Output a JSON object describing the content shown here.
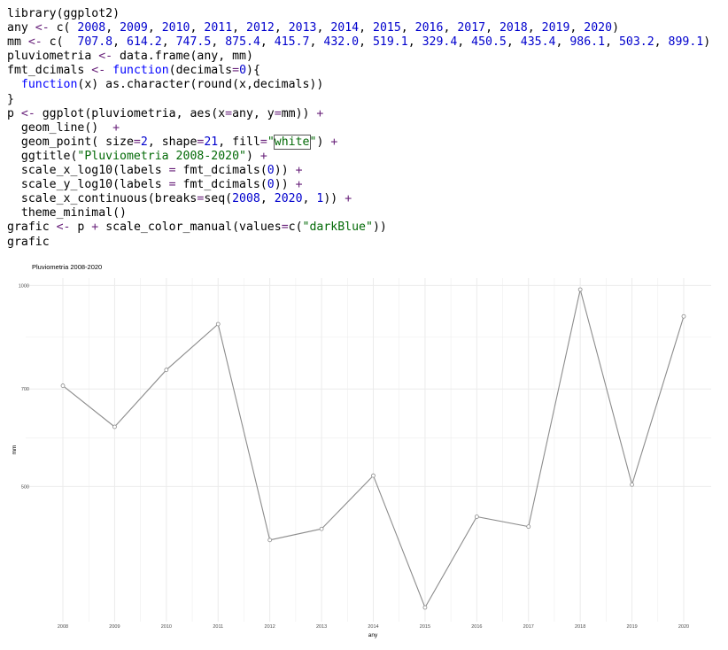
{
  "code": {
    "lines": [
      [
        {
          "t": "library(ggplot2)"
        }
      ],
      [
        {
          "t": "any "
        },
        {
          "t": "<-",
          "c": "op"
        },
        {
          "t": " c( "
        },
        {
          "t": "2008",
          "c": "num"
        },
        {
          "t": ", "
        },
        {
          "t": "2009",
          "c": "num"
        },
        {
          "t": ", "
        },
        {
          "t": "2010",
          "c": "num"
        },
        {
          "t": ", "
        },
        {
          "t": "2011",
          "c": "num"
        },
        {
          "t": ", "
        },
        {
          "t": "2012",
          "c": "num"
        },
        {
          "t": ", "
        },
        {
          "t": "2013",
          "c": "num"
        },
        {
          "t": ", "
        },
        {
          "t": "2014",
          "c": "num"
        },
        {
          "t": ", "
        },
        {
          "t": "2015",
          "c": "num"
        },
        {
          "t": ", "
        },
        {
          "t": "2016",
          "c": "num"
        },
        {
          "t": ", "
        },
        {
          "t": "2017",
          "c": "num"
        },
        {
          "t": ", "
        },
        {
          "t": "2018",
          "c": "num"
        },
        {
          "t": ", "
        },
        {
          "t": "2019",
          "c": "num"
        },
        {
          "t": ", "
        },
        {
          "t": "2020",
          "c": "num"
        },
        {
          "t": ")"
        }
      ],
      [
        {
          "t": "mm "
        },
        {
          "t": "<-",
          "c": "op"
        },
        {
          "t": " c(  "
        },
        {
          "t": "707.8",
          "c": "num"
        },
        {
          "t": ", "
        },
        {
          "t": "614.2",
          "c": "num"
        },
        {
          "t": ", "
        },
        {
          "t": "747.5",
          "c": "num"
        },
        {
          "t": ", "
        },
        {
          "t": "875.4",
          "c": "num"
        },
        {
          "t": ", "
        },
        {
          "t": "415.7",
          "c": "num"
        },
        {
          "t": ", "
        },
        {
          "t": "432.0",
          "c": "num"
        },
        {
          "t": ", "
        },
        {
          "t": "519.1",
          "c": "num"
        },
        {
          "t": ", "
        },
        {
          "t": "329.4",
          "c": "num"
        },
        {
          "t": ", "
        },
        {
          "t": "450.5",
          "c": "num"
        },
        {
          "t": ", "
        },
        {
          "t": "435.4",
          "c": "num"
        },
        {
          "t": ", "
        },
        {
          "t": "986.1",
          "c": "num"
        },
        {
          "t": ", "
        },
        {
          "t": "503.2",
          "c": "num"
        },
        {
          "t": ", "
        },
        {
          "t": "899.1",
          "c": "num"
        },
        {
          "t": ")"
        }
      ],
      [
        {
          "t": "pluviometria "
        },
        {
          "t": "<-",
          "c": "op"
        },
        {
          "t": " data.frame(any, mm)"
        }
      ],
      [
        {
          "t": "fmt_dcimals "
        },
        {
          "t": "<-",
          "c": "op"
        },
        {
          "t": " "
        },
        {
          "t": "function",
          "c": "kw"
        },
        {
          "t": "(decimals"
        },
        {
          "t": "=",
          "c": "op"
        },
        {
          "t": "0",
          "c": "num"
        },
        {
          "t": "){"
        }
      ],
      [
        {
          "t": "  "
        },
        {
          "t": "function",
          "c": "kw"
        },
        {
          "t": "(x) as.character(round(x,decimals))"
        }
      ],
      [
        {
          "t": "}"
        }
      ],
      [
        {
          "t": "p "
        },
        {
          "t": "<-",
          "c": "op"
        },
        {
          "t": " ggplot(pluviometria, aes(x"
        },
        {
          "t": "=",
          "c": "op"
        },
        {
          "t": "any, y"
        },
        {
          "t": "=",
          "c": "op"
        },
        {
          "t": "mm)) "
        },
        {
          "t": "+",
          "c": "op"
        }
      ],
      [
        {
          "t": "  geom_line()  "
        },
        {
          "t": "+",
          "c": "op"
        }
      ],
      [
        {
          "t": "  geom_point( size"
        },
        {
          "t": "=",
          "c": "op"
        },
        {
          "t": "2",
          "c": "num"
        },
        {
          "t": ", shape"
        },
        {
          "t": "=",
          "c": "op"
        },
        {
          "t": "21",
          "c": "num"
        },
        {
          "t": ", fill"
        },
        {
          "t": "=",
          "c": "op"
        },
        {
          "t": "\"",
          "c": "str"
        },
        {
          "t": "white",
          "c": "str boxed"
        },
        {
          "t": "\"",
          "c": "str"
        },
        {
          "t": ") "
        },
        {
          "t": "+",
          "c": "op"
        }
      ],
      [
        {
          "t": "  ggtitle("
        },
        {
          "t": "\"Pluviometria 2008-2020\"",
          "c": "str"
        },
        {
          "t": ") "
        },
        {
          "t": "+",
          "c": "op"
        }
      ],
      [
        {
          "t": "  scale_x_log10(labels "
        },
        {
          "t": "=",
          "c": "op"
        },
        {
          "t": " fmt_dcimals("
        },
        {
          "t": "0",
          "c": "num"
        },
        {
          "t": ")) "
        },
        {
          "t": "+",
          "c": "op"
        }
      ],
      [
        {
          "t": "  scale_y_log10(labels "
        },
        {
          "t": "=",
          "c": "op"
        },
        {
          "t": " fmt_dcimals("
        },
        {
          "t": "0",
          "c": "num"
        },
        {
          "t": ")) "
        },
        {
          "t": "+",
          "c": "op"
        }
      ],
      [
        {
          "t": "  scale_x_continuous(breaks"
        },
        {
          "t": "=",
          "c": "op"
        },
        {
          "t": "seq("
        },
        {
          "t": "2008",
          "c": "num"
        },
        {
          "t": ", "
        },
        {
          "t": "2020",
          "c": "num"
        },
        {
          "t": ", "
        },
        {
          "t": "1",
          "c": "num"
        },
        {
          "t": ")) "
        },
        {
          "t": "+",
          "c": "op"
        }
      ],
      [
        {
          "t": "  theme_minimal()"
        }
      ],
      [
        {
          "t": "grafic "
        },
        {
          "t": "<-",
          "c": "op"
        },
        {
          "t": " p "
        },
        {
          "t": "+",
          "c": "op"
        },
        {
          "t": " scale_color_manual(values"
        },
        {
          "t": "=",
          "c": "op"
        },
        {
          "t": "c("
        },
        {
          "t": "\"darkBlue\"",
          "c": "str"
        },
        {
          "t": "))"
        }
      ],
      [
        {
          "t": "grafic"
        }
      ]
    ]
  },
  "chart_data": {
    "type": "line",
    "title": "Pluviometria 2008-2020",
    "xlabel": "any",
    "ylabel": "mm",
    "x": [
      2008,
      2009,
      2010,
      2011,
      2012,
      2013,
      2014,
      2015,
      2016,
      2017,
      2018,
      2019,
      2020
    ],
    "y": [
      707.8,
      614.2,
      747.5,
      875.4,
      415.7,
      432.0,
      519.1,
      329.4,
      450.5,
      435.4,
      986.1,
      503.2,
      899.1
    ],
    "x_ticks": [
      "2008",
      "2009",
      "2010",
      "2011",
      "2012",
      "2013",
      "2014",
      "2015",
      "2016",
      "2017",
      "2018",
      "2019",
      "2020"
    ],
    "y_ticks": [
      {
        "value": 500,
        "label": "500"
      },
      {
        "value": 700,
        "label": "700"
      },
      {
        "value": 1000,
        "label": "1000"
      }
    ],
    "y_scale": "log10",
    "ylim": [
      329.4,
      986.1
    ],
    "xlim": [
      2008,
      2020
    ],
    "grid": true,
    "line_color": "#8c8c8c",
    "point_fill": "#ffffff",
    "grid_color": "#ebebeb"
  }
}
